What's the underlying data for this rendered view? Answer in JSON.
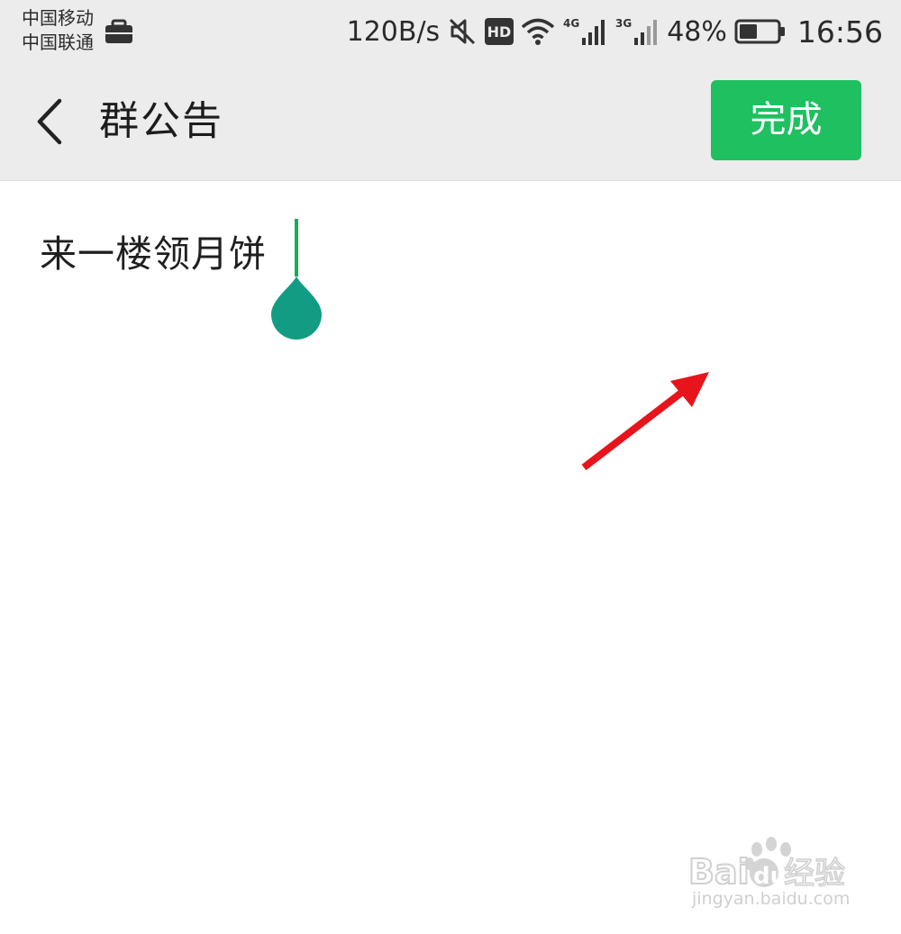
{
  "status_bar": {
    "carrier_1": "中国移动",
    "carrier_2": "中国联通",
    "net_speed": "120B/s",
    "hd_badge": "HD",
    "signal_1_label": "4G",
    "signal_2_label": "3G",
    "battery_percent": "48%",
    "battery_level": 0.48,
    "time": "16:56",
    "icons": [
      "briefcase-icon",
      "mute-icon",
      "hd-icon",
      "wifi-icon",
      "signal-4g-icon",
      "signal-3g-icon",
      "battery-icon"
    ]
  },
  "header": {
    "back_icon": "chevron-left-icon",
    "title": "群公告",
    "done_label": "完成"
  },
  "editor": {
    "text": "来一楼领月饼"
  },
  "annotation": {
    "arrow_color": "#e8141c"
  },
  "watermark": {
    "logo_text": "Baidu经验",
    "url": "jingyan.baidu.com"
  },
  "colors": {
    "accent_green": "#1ec060",
    "cursor_green": "#19ad55",
    "handle_teal": "#139c84",
    "header_bg": "#ececec"
  }
}
